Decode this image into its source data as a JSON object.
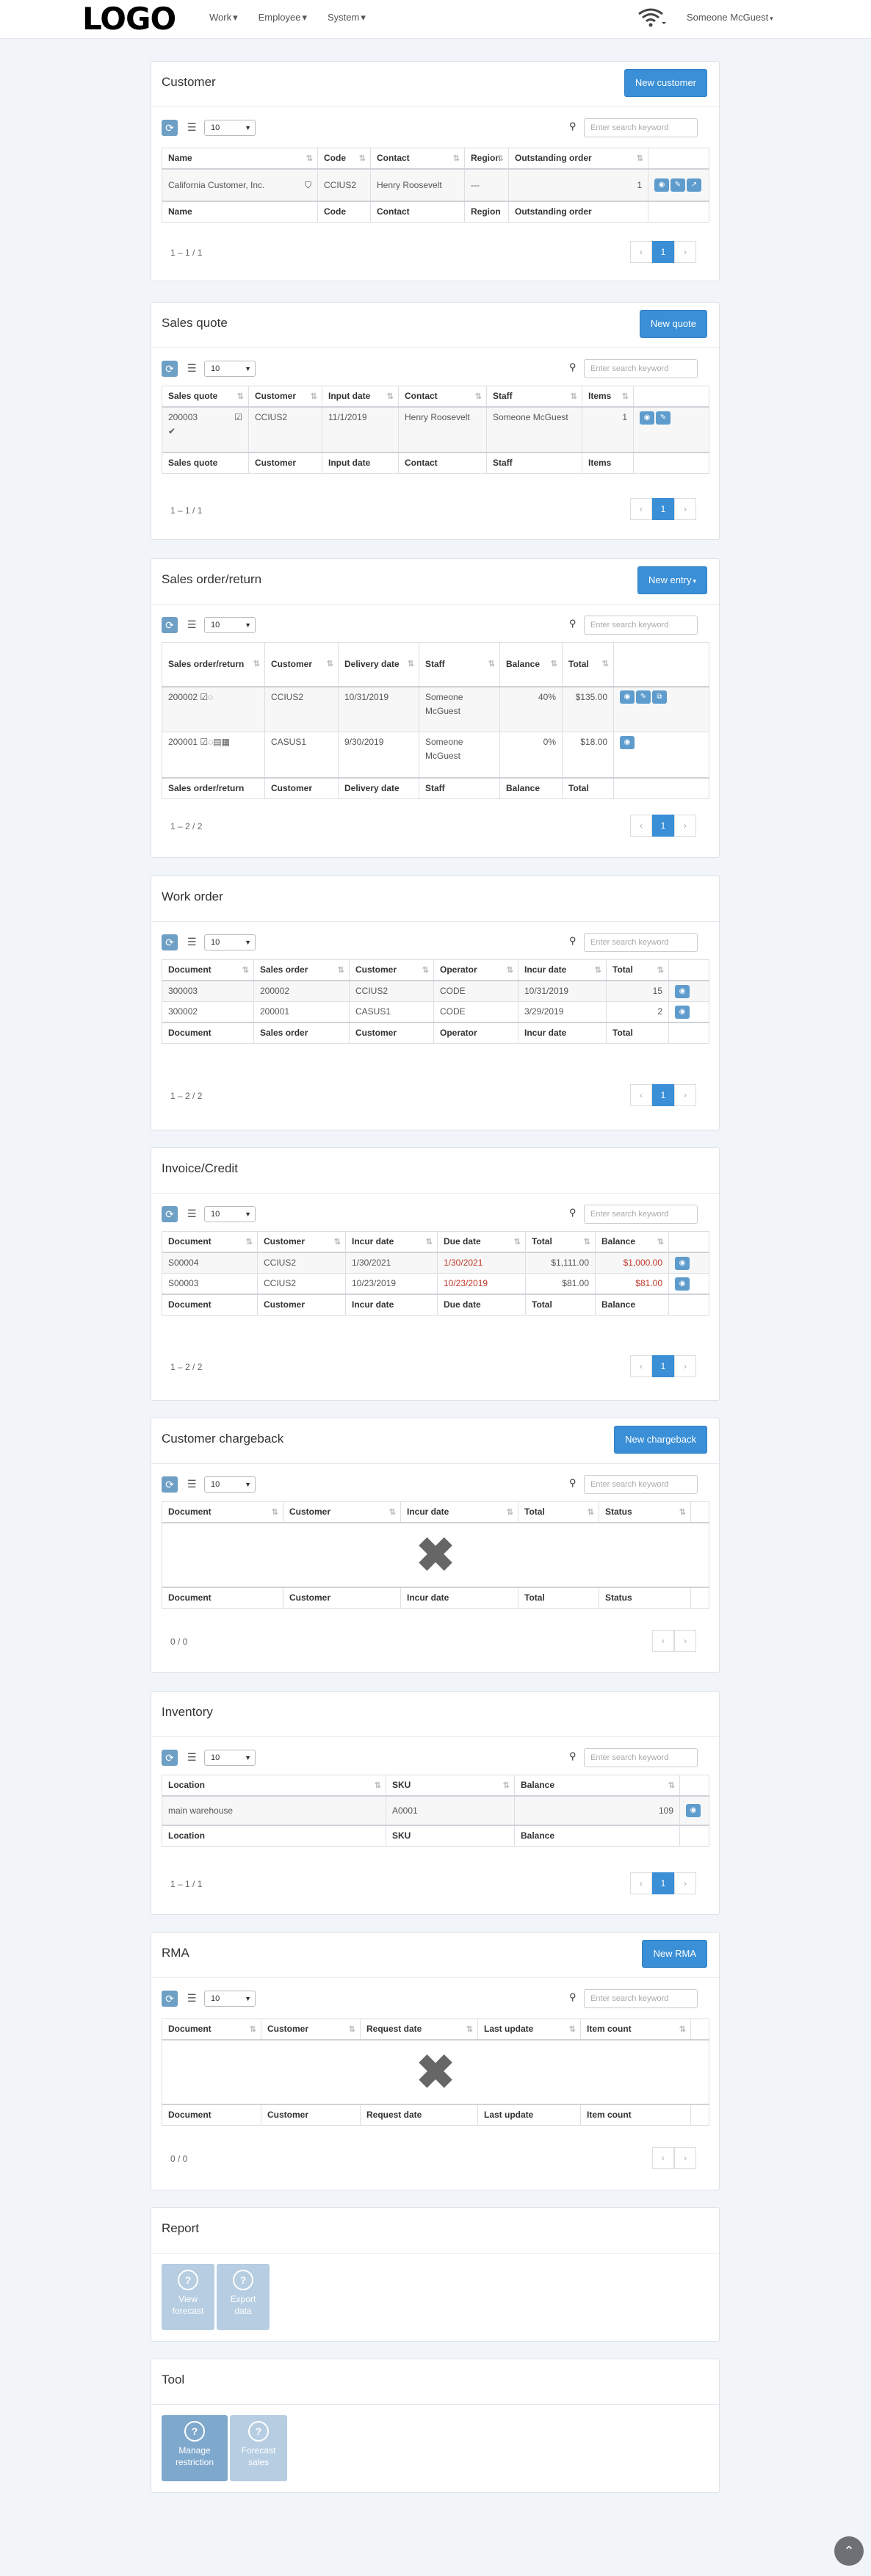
{
  "nav": {
    "logo": "LOGO",
    "menu": [
      {
        "label": "Work"
      },
      {
        "label": "Employee"
      },
      {
        "label": "System"
      }
    ],
    "user": "Someone McGuest"
  },
  "common": {
    "page_size": "10",
    "search_placeholder": "Enter search keyword",
    "empty_info": "0 / 0",
    "prev": "‹",
    "next": "›",
    "page": "1"
  },
  "customer": {
    "title": "Customer",
    "new_button": "New customer",
    "columns": [
      "Name",
      "Code",
      "Contact",
      "Region",
      "Outstanding order"
    ],
    "rows": [
      {
        "name": "California Customer, Inc.",
        "code": "CCIUS2",
        "contact": "Henry Roosevelt",
        "region": "---",
        "outstanding": "1"
      }
    ],
    "info": "1 – 1 / 1"
  },
  "sales_quote": {
    "title": "Sales quote",
    "new_button": "New quote",
    "columns": [
      "Sales quote",
      "Customer",
      "Input date",
      "Contact",
      "Staff",
      "Items"
    ],
    "rows": [
      {
        "quote": "200003",
        "customer": "CCIUS2",
        "input_date": "11/1/2019",
        "contact": "Henry Roosevelt",
        "staff": "Someone McGuest",
        "items": "1"
      }
    ],
    "info": "1 – 1 / 1"
  },
  "sales_order": {
    "title": "Sales order/return",
    "new_button": "New entry",
    "columns": [
      "Sales order/return",
      "Customer",
      "Delivery date",
      "Staff",
      "Balance",
      "Total"
    ],
    "rows": [
      {
        "order": "200002",
        "customer": "CCIUS2",
        "delivery": "10/31/2019",
        "staff": "Someone McGuest",
        "balance": "40%",
        "total": "$135.00"
      },
      {
        "order": "200001",
        "customer": "CASUS1",
        "delivery": "9/30/2019",
        "staff": "Someone McGuest",
        "balance": "0%",
        "total": "$18.00"
      }
    ],
    "info": "1 – 2 / 2"
  },
  "work_order": {
    "title": "Work order",
    "columns": [
      "Document",
      "Sales order",
      "Customer",
      "Operator",
      "Incur date",
      "Total"
    ],
    "rows": [
      {
        "doc": "300003",
        "so": "200002",
        "customer": "CCIUS2",
        "operator": "CODE",
        "incur": "10/31/2019",
        "total": "15"
      },
      {
        "doc": "300002",
        "so": "200001",
        "customer": "CASUS1",
        "operator": "CODE",
        "incur": "3/29/2019",
        "total": "2"
      }
    ],
    "info": "1 – 2 / 2"
  },
  "invoice": {
    "title": "Invoice/Credit",
    "columns": [
      "Document",
      "Customer",
      "Incur date",
      "Due date",
      "Total",
      "Balance"
    ],
    "rows": [
      {
        "doc": "S00004",
        "customer": "CCIUS2",
        "incur": "1/30/2021",
        "due": "1/30/2021",
        "total": "$1,111.00",
        "balance": "$1,000.00"
      },
      {
        "doc": "S00003",
        "customer": "CCIUS2",
        "incur": "10/23/2019",
        "due": "10/23/2019",
        "total": "$81.00",
        "balance": "$81.00"
      }
    ],
    "info": "1 – 2 / 2",
    "alert_color": "#c0392b"
  },
  "chargeback": {
    "title": "Customer chargeback",
    "new_button": "New chargeback",
    "columns": [
      "Document",
      "Customer",
      "Incur date",
      "Total",
      "Status"
    ]
  },
  "inventory": {
    "title": "Inventory",
    "columns": [
      "Location",
      "SKU",
      "Balance"
    ],
    "rows": [
      {
        "location": "main warehouse",
        "sku": "A0001",
        "balance": "109"
      }
    ],
    "info": "1 – 1 / 1"
  },
  "rma": {
    "title": "RMA",
    "new_button": "New RMA",
    "columns": [
      "Document",
      "Customer",
      "Request date",
      "Last update",
      "Item count"
    ]
  },
  "report": {
    "title": "Report",
    "tiles": [
      {
        "line1": "View",
        "line2": "forecast"
      },
      {
        "line1": "Export",
        "line2": "data"
      }
    ]
  },
  "tool": {
    "title": "Tool",
    "tiles": [
      {
        "line1": "Manage",
        "line2": "restriction"
      },
      {
        "line1": "Forecast",
        "line2": "sales"
      }
    ]
  },
  "colors": {
    "primary": "#3a8fd6",
    "background": "#f1f4f8"
  }
}
